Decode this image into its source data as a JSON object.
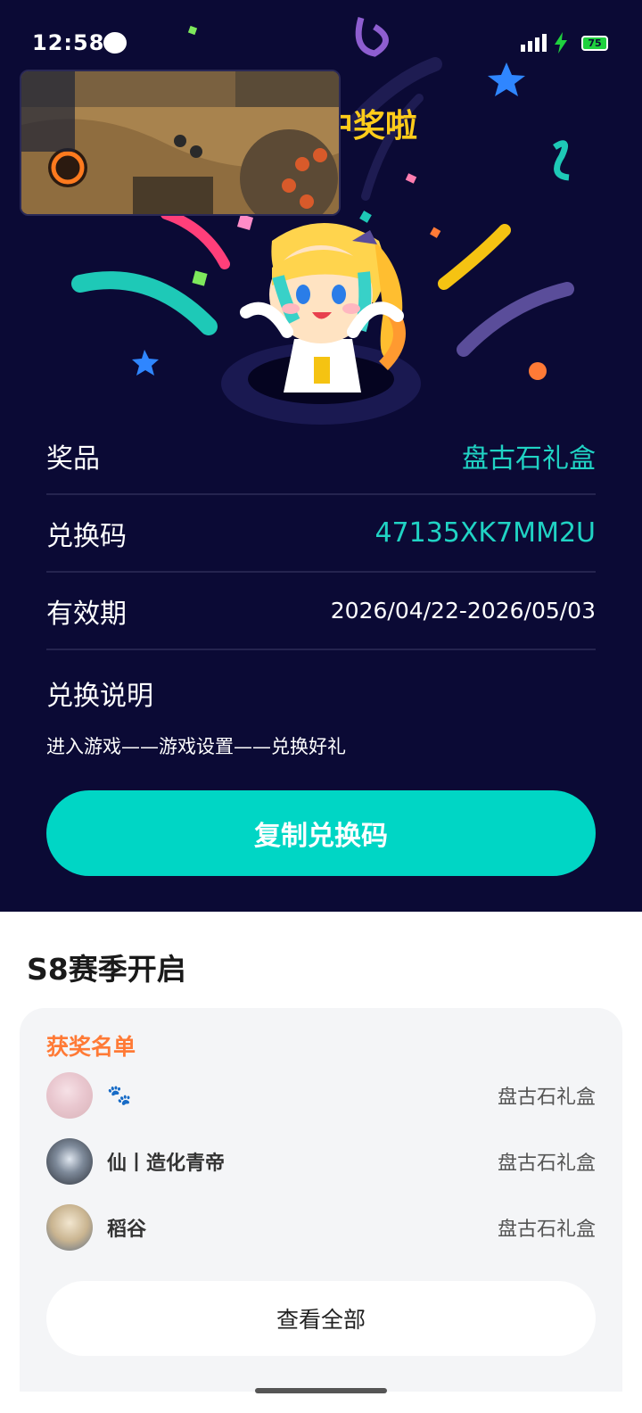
{
  "status_bar": {
    "time": "12:58",
    "battery": "75"
  },
  "hero": {
    "headline": "中奖啦"
  },
  "info": {
    "prize_label": "奖品",
    "prize_value": "盘古石礼盒",
    "code_label": "兑换码",
    "code_value": "47135XK7MM2U",
    "validity_label": "有效期",
    "validity_value": "2026/04/22-2026/05/03",
    "instructions_label": "兑换说明",
    "instructions_text": "进入游戏——游戏设置——兑换好礼"
  },
  "copy_button": "复制兑换码",
  "season": {
    "title": "S8赛季开启",
    "winners_title": "获奖名单",
    "winners": [
      {
        "name": "🐾",
        "prize": "盘古石礼盒"
      },
      {
        "name": "仙丨造化青帝",
        "prize": "盘古石礼盒"
      },
      {
        "name": "稻谷",
        "prize": "盘古石礼盒"
      }
    ],
    "view_all": "查看全部"
  },
  "colors": {
    "background": "#0b0a35",
    "accent": "#00d6c5",
    "headline": "#ffcc1a",
    "winners_title": "#ff7a36"
  }
}
